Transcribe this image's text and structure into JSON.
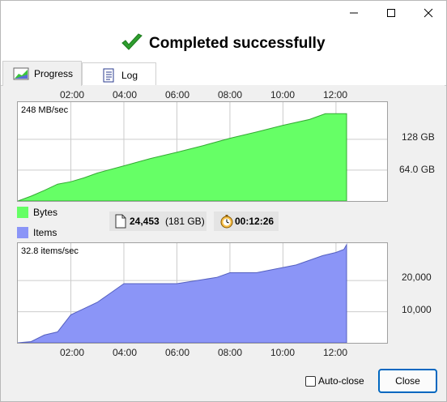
{
  "window": {
    "title_icon_close": "close-icon",
    "colors": {
      "accent": "#0067c0",
      "bytes_fill": "#66ff66",
      "items_fill": "#8b95f7"
    }
  },
  "header": {
    "title": "Completed successfully",
    "icon": "green-check-icon"
  },
  "tabs": [
    {
      "label": "Progress",
      "icon": "chart-icon",
      "selected": true
    },
    {
      "label": "Log",
      "icon": "log-icon",
      "selected": false
    }
  ],
  "time_axis": {
    "ticks": [
      "02:00",
      "04:00",
      "06:00",
      "08:00",
      "10:00",
      "12:00"
    ]
  },
  "bytes_chart": {
    "rate_label": "248 MB/sec",
    "y_ticks": [
      "128 GB",
      "64.0 GB"
    ]
  },
  "legend": {
    "bytes": "Bytes",
    "items": "Items"
  },
  "stats": {
    "items_count": "24,453",
    "items_size": "(181 GB)",
    "elapsed": "00:12:26"
  },
  "items_chart": {
    "rate_label": "32.8 items/sec",
    "y_ticks": [
      "20,000",
      "10,000"
    ]
  },
  "footer": {
    "autoclose_label": "Auto-close",
    "autoclose_checked": false,
    "close_label": "Close"
  },
  "chart_data": [
    {
      "type": "area",
      "name": "Bytes",
      "ylabel": "GB",
      "xlim": [
        0,
        12.4
      ],
      "ylim": [
        0,
        205
      ],
      "x": [
        0,
        0.5,
        1.0,
        1.5,
        2.0,
        2.5,
        3.0,
        4.0,
        5.0,
        6.0,
        7.0,
        8.0,
        9.0,
        10.0,
        11.0,
        11.6,
        12.0,
        12.4
      ],
      "y": [
        0,
        10,
        22,
        35,
        40,
        48,
        58,
        73,
        88,
        101,
        115,
        130,
        143,
        157,
        169,
        181,
        181,
        181
      ],
      "y_ticks": [
        64,
        128
      ]
    },
    {
      "type": "area",
      "name": "Items",
      "ylabel": "items",
      "xlim": [
        0,
        12.4
      ],
      "ylim": [
        0,
        32000
      ],
      "x": [
        0,
        0.5,
        1.0,
        1.5,
        2.0,
        2.5,
        3.0,
        3.5,
        4.0,
        6.0,
        7.5,
        8.0,
        9.0,
        10.5,
        11.0,
        11.5,
        12.0,
        12.3,
        12.4
      ],
      "y": [
        0,
        400,
        2500,
        3500,
        9000,
        11000,
        13000,
        16000,
        19000,
        19000,
        21000,
        22500,
        22500,
        25000,
        26500,
        28000,
        29000,
        30000,
        31500
      ],
      "y_ticks": [
        10000,
        20000
      ]
    }
  ]
}
